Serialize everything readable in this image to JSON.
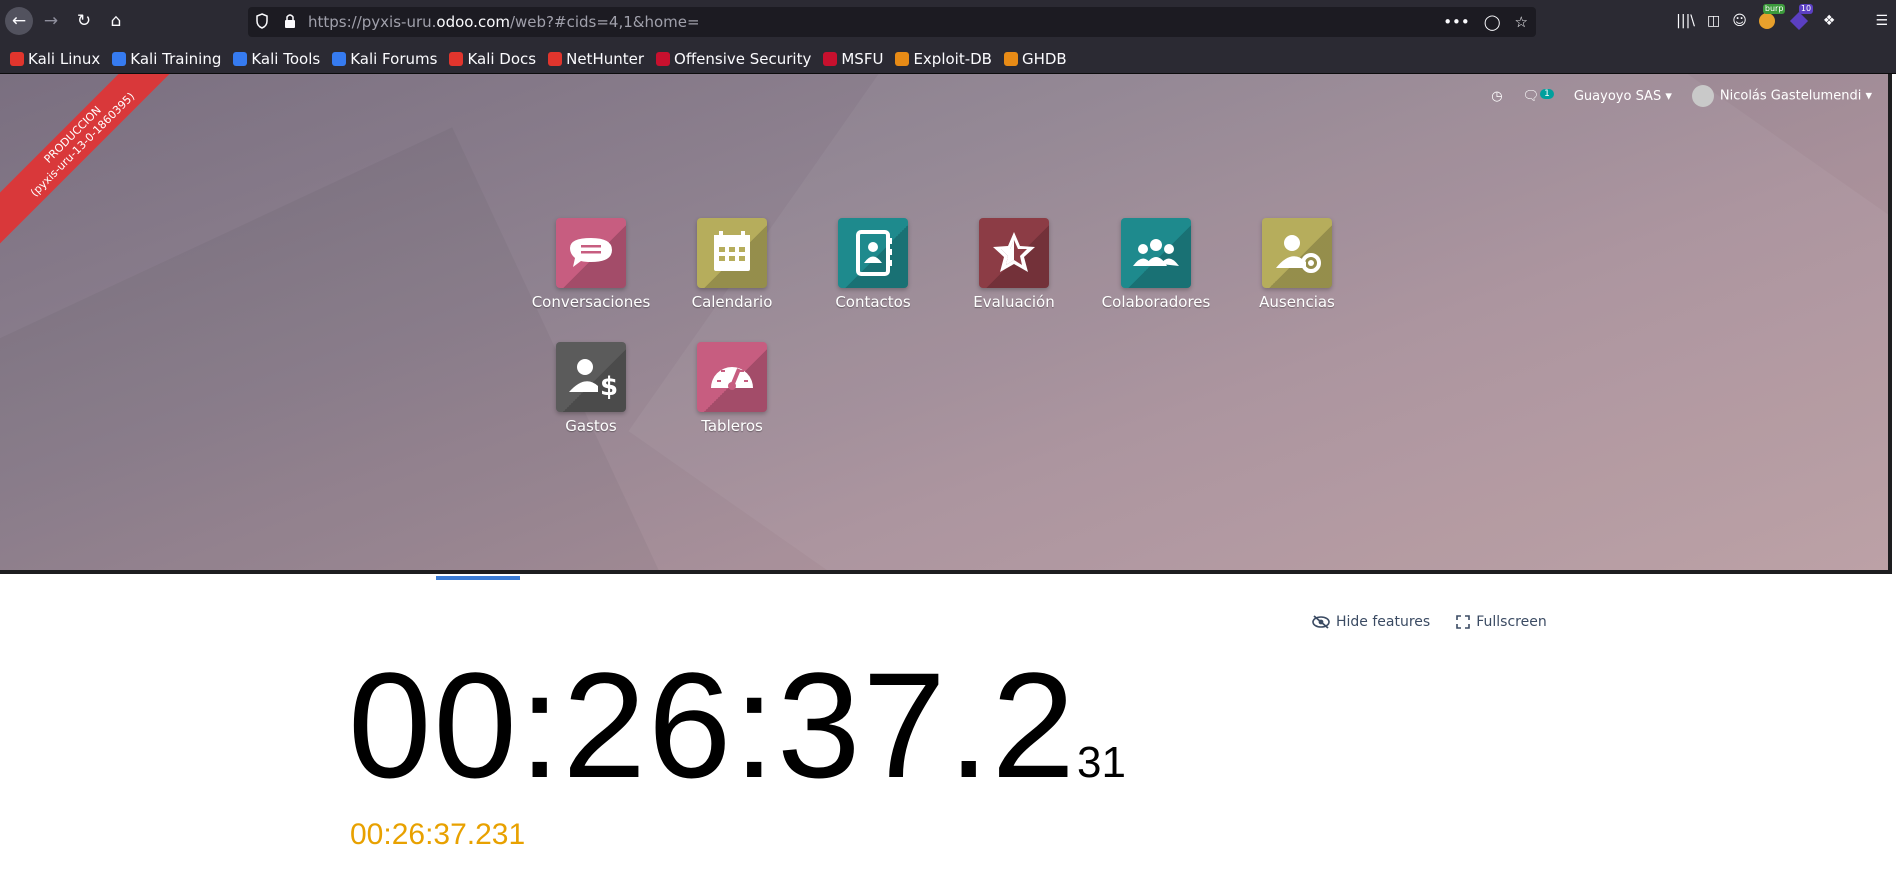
{
  "browser": {
    "url_prefix": "https://pyxis-uru.",
    "url_host": "odoo.com",
    "url_suffix": "/web?#cids=4,1&home=",
    "back_icon": "arrow-left-icon",
    "forward_icon": "arrow-right-icon",
    "reload_icon": "reload-icon",
    "home_icon": "home-icon",
    "burp_badge": "burp",
    "ext_count_badge": "10"
  },
  "bookmarks": [
    {
      "label": "Kali Linux",
      "color": "#e1352d"
    },
    {
      "label": "Kali Training",
      "color": "#367bf0"
    },
    {
      "label": "Kali Tools",
      "color": "#367bf0"
    },
    {
      "label": "Kali Forums",
      "color": "#367bf0"
    },
    {
      "label": "Kali Docs",
      "color": "#e1352d"
    },
    {
      "label": "NetHunter",
      "color": "#e1352d"
    },
    {
      "label": "Offensive Security",
      "color": "#c8102e"
    },
    {
      "label": "MSFU",
      "color": "#c8102e"
    },
    {
      "label": "Exploit-DB",
      "color": "#e88b16"
    },
    {
      "label": "GHDB",
      "color": "#e88b16"
    }
  ],
  "odoo": {
    "ribbon_line1": "PRODUCCION",
    "ribbon_line2": "(pyxis-uru-13-0-1860395)",
    "messages_count": "1",
    "company": "Guayoyo SAS",
    "user": "Nicolás Gastelumendi",
    "apps": [
      {
        "label": "Conversaciones",
        "color": "#c75d80"
      },
      {
        "label": "Calendario",
        "color": "#b6ad5c"
      },
      {
        "label": "Contactos",
        "color": "#1e8a8d"
      },
      {
        "label": "Evaluación",
        "color": "#8c3c45"
      },
      {
        "label": "Colaboradores",
        "color": "#1e8a8d"
      },
      {
        "label": "Ausencias",
        "color": "#b6ad5c"
      },
      {
        "label": "Gastos",
        "color": "#5b5b5b"
      },
      {
        "label": "Tableros",
        "color": "#c75d80"
      }
    ]
  },
  "page": {
    "hide_features": "Hide features",
    "fullscreen": "Fullscreen",
    "clock_main": "00:26:37.2",
    "clock_ms": "31",
    "clock_small": "00:26:37.231"
  }
}
